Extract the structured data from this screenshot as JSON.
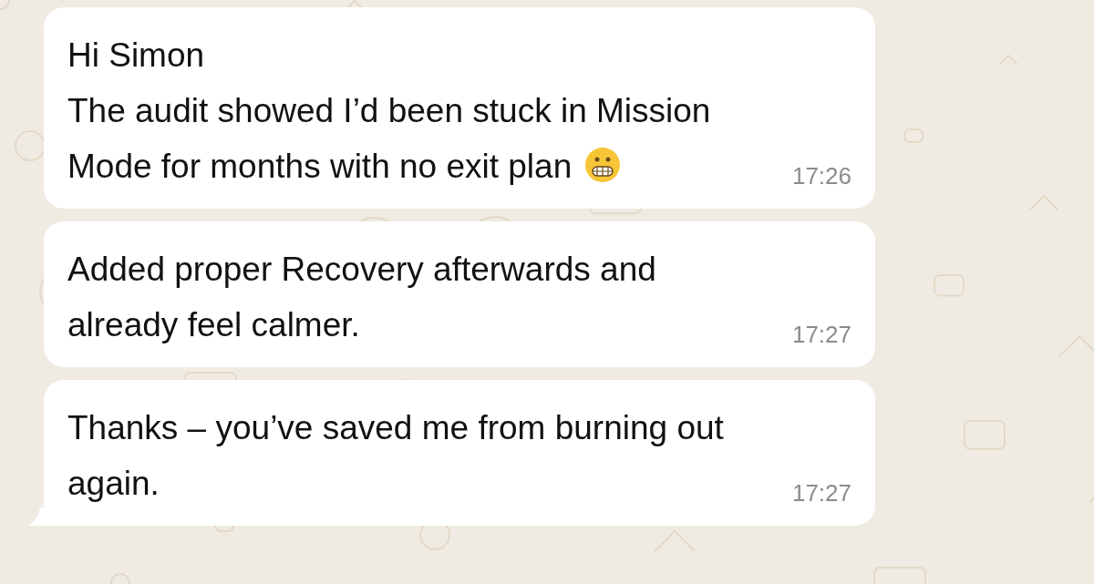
{
  "messages": [
    {
      "paragraphs": [
        "Hi Simon",
        "The audit showed I’d been stuck in Mission Mode for months with no exit plan"
      ],
      "trailing_emoji": true,
      "time": "17:26",
      "tail": false
    },
    {
      "paragraphs": [
        "Added proper Recovery afterwards and already feel calmer."
      ],
      "time": "17:27",
      "tail": false
    },
    {
      "paragraphs": [
        "Thanks – you’ve saved me from burning out again."
      ],
      "time": "17:27",
      "tail": true
    }
  ]
}
